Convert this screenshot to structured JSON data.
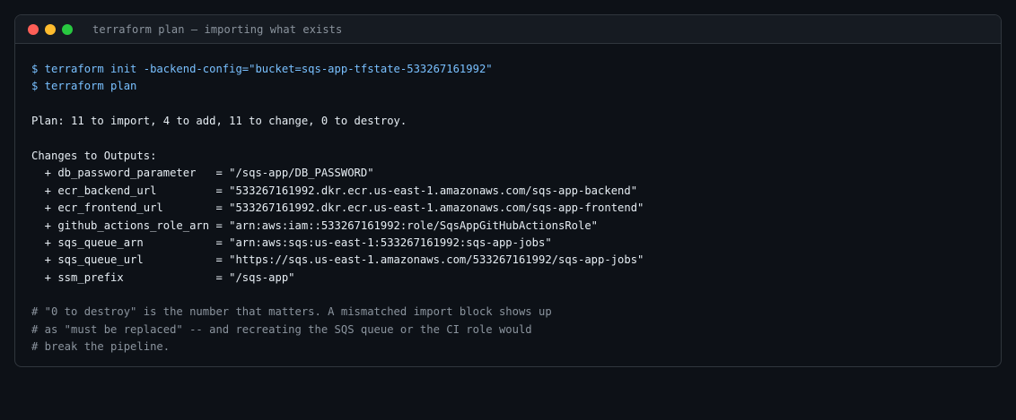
{
  "window": {
    "title": "terraform plan — importing what exists",
    "controls": [
      {
        "name": "close",
        "color": "#ff5f57"
      },
      {
        "name": "minimize",
        "color": "#febc2e"
      },
      {
        "name": "maximize",
        "color": "#28c840"
      }
    ]
  },
  "colors": {
    "background": "#0d1117",
    "titlebar": "#161b22",
    "border": "#30363d",
    "command": "#79c0ff",
    "text": "#e6edf3",
    "comment": "#8b949e"
  },
  "terminal": {
    "commands": [
      "$ terraform init -backend-config=\"bucket=sqs-app-tfstate-533267161992\"",
      "$ terraform plan"
    ],
    "plan_summary": "Plan: 11 to import, 4 to add, 11 to change, 0 to destroy.",
    "outputs_header": "Changes to Outputs:",
    "outputs": [
      "  + db_password_parameter   = \"/sqs-app/DB_PASSWORD\"",
      "  + ecr_backend_url         = \"533267161992.dkr.ecr.us-east-1.amazonaws.com/sqs-app-backend\"",
      "  + ecr_frontend_url        = \"533267161992.dkr.ecr.us-east-1.amazonaws.com/sqs-app-frontend\"",
      "  + github_actions_role_arn = \"arn:aws:iam::533267161992:role/SqsAppGitHubActionsRole\"",
      "  + sqs_queue_arn           = \"arn:aws:sqs:us-east-1:533267161992:sqs-app-jobs\"",
      "  + sqs_queue_url           = \"https://sqs.us-east-1.amazonaws.com/533267161992/sqs-app-jobs\"",
      "  + ssm_prefix              = \"/sqs-app\""
    ],
    "comments": [
      "# \"0 to destroy\" is the number that matters. A mismatched import block shows up",
      "# as \"must be replaced\" -- and recreating the SQS queue or the CI role would",
      "# break the pipeline."
    ]
  }
}
